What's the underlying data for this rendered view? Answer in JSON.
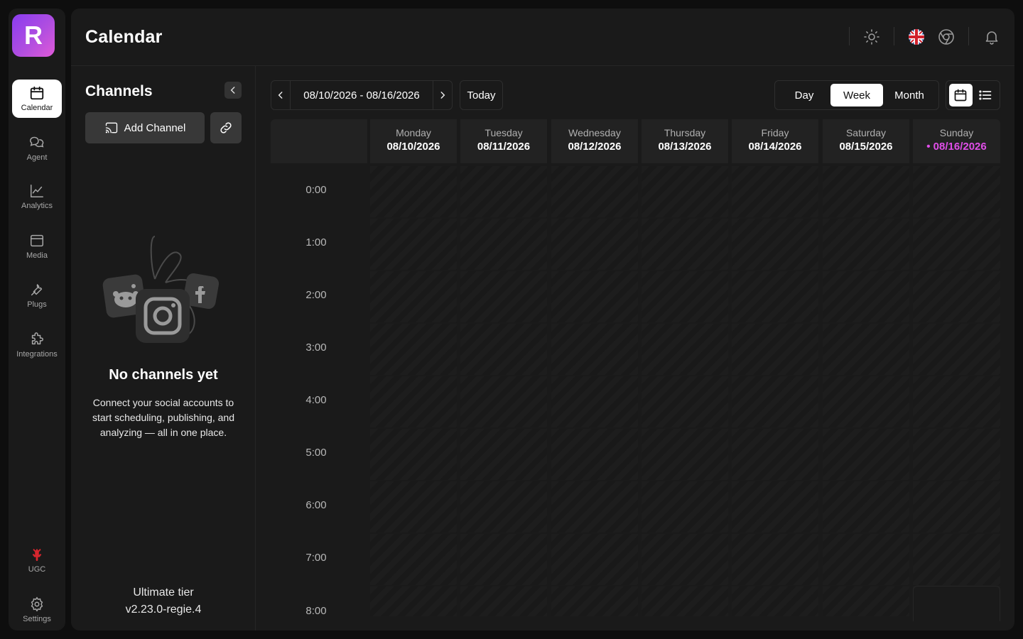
{
  "app": {
    "logo_letter": "R",
    "brand_gradient": [
      "#8a3cf0",
      "#e05ad8"
    ],
    "accent_today": "#e04ee8"
  },
  "sidebar": {
    "items": [
      {
        "label": "Calendar",
        "icon": "calendar-icon",
        "active": true
      },
      {
        "label": "Agent",
        "icon": "chat-icon",
        "active": false
      },
      {
        "label": "Analytics",
        "icon": "chart-icon",
        "active": false
      },
      {
        "label": "Media",
        "icon": "media-icon",
        "active": false
      },
      {
        "label": "Plugs",
        "icon": "wrench-icon",
        "active": false
      },
      {
        "label": "Integrations",
        "icon": "puzzle-icon",
        "active": false
      }
    ],
    "bottom": [
      {
        "label": "UGC",
        "icon": "ugc-icon"
      },
      {
        "label": "Settings",
        "icon": "gear-icon"
      }
    ]
  },
  "header": {
    "title": "Calendar",
    "icons": [
      "sun-icon",
      "uk-flag-icon",
      "chrome-icon",
      "bell-icon"
    ]
  },
  "channels": {
    "title": "Channels",
    "add_label": "Add Channel",
    "empty_title": "No channels yet",
    "empty_desc": "Connect your social accounts to start scheduling, publishing, and analyzing — all in one place.",
    "tier": "Ultimate tier",
    "version": "v2.23.0-regie.4"
  },
  "toolbar": {
    "range": "08/10/2026 - 08/16/2026",
    "today": "Today",
    "views": [
      "Day",
      "Week",
      "Month"
    ],
    "active_view": "Week"
  },
  "week": {
    "days": [
      {
        "name": "Monday",
        "date": "08/10/2026"
      },
      {
        "name": "Tuesday",
        "date": "08/11/2026"
      },
      {
        "name": "Wednesday",
        "date": "08/12/2026"
      },
      {
        "name": "Thursday",
        "date": "08/13/2026"
      },
      {
        "name": "Friday",
        "date": "08/14/2026"
      },
      {
        "name": "Saturday",
        "date": "08/15/2026"
      },
      {
        "name": "Sunday",
        "date": "• 08/16/2026",
        "today": true
      }
    ],
    "hours": [
      "0:00",
      "1:00",
      "2:00",
      "3:00",
      "4:00",
      "5:00",
      "6:00",
      "7:00",
      "8:00"
    ]
  }
}
